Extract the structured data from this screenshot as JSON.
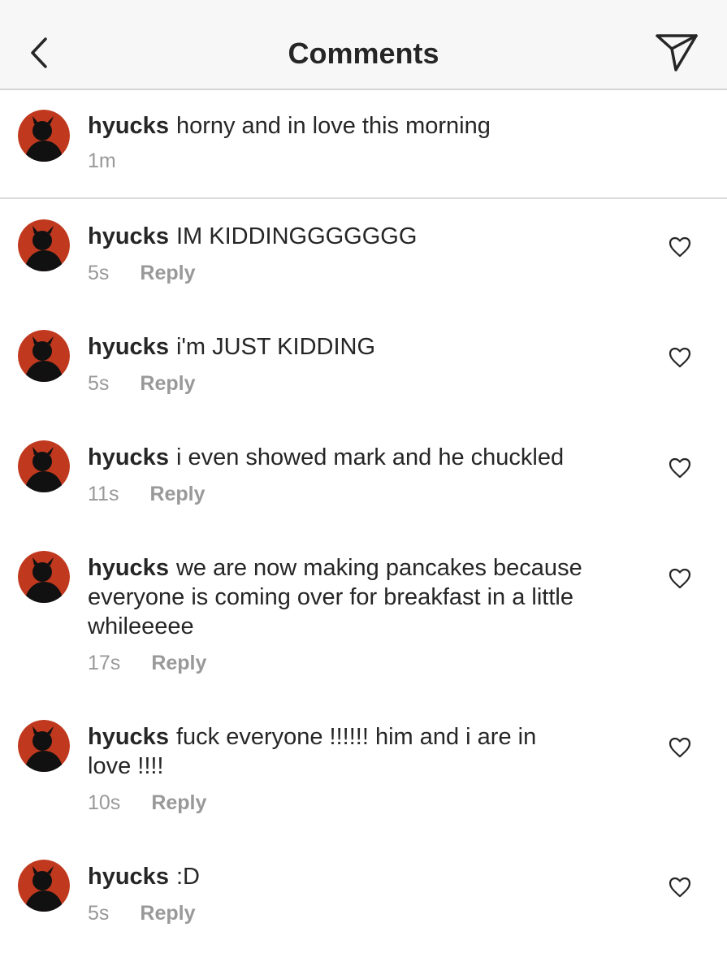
{
  "header": {
    "title": "Comments"
  },
  "icons": {
    "back": "chevron-left-icon",
    "send": "paper-plane-icon",
    "like": "heart-outline-icon"
  },
  "colors": {
    "avatar_bg": "#c0391e",
    "secondary_text": "#999999"
  },
  "caption": {
    "username": "hyucks",
    "text": "horny and in love this morning",
    "time": "1m"
  },
  "comments": [
    {
      "username": "hyucks",
      "text": "IM KIDDINGGGGGGG",
      "time": "5s",
      "reply_label": "Reply"
    },
    {
      "username": "hyucks",
      "text": "i'm JUST KIDDING",
      "time": "5s",
      "reply_label": "Reply"
    },
    {
      "username": "hyucks",
      "text": "i even showed mark and he chuckled",
      "time": "11s",
      "reply_label": "Reply"
    },
    {
      "username": "hyucks",
      "text": "we are now making pancakes because everyone is coming over for breakfast in a little whileeeee",
      "time": "17s",
      "reply_label": "Reply"
    },
    {
      "username": "hyucks",
      "text": "fuck everyone !!!!!! him and i are in love !!!!",
      "time": "10s",
      "reply_label": "Reply"
    },
    {
      "username": "hyucks",
      "text": ":D",
      "time": "5s",
      "reply_label": "Reply"
    }
  ]
}
